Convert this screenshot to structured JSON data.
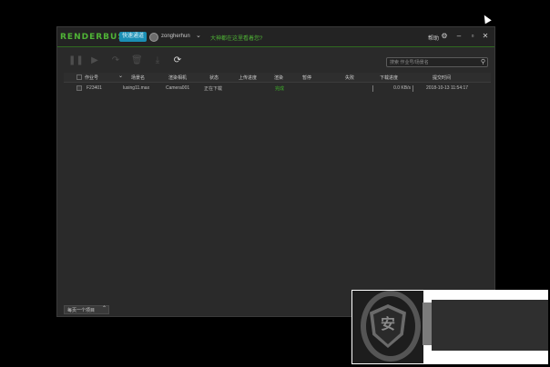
{
  "app": {
    "logo": "RENDERBUS",
    "logo_badge": "快速通道",
    "username": "zongherhun",
    "promo_link": "大神都在这里看着您?",
    "help_label": "帮助",
    "accent": "#4fb336"
  },
  "window_controls": {
    "settings_icon": "gear-icon",
    "minimize_icon": "minimize-icon",
    "maximize_icon": "maximize-icon",
    "close_icon": "close-icon"
  },
  "toolbar": {
    "tools": [
      "pause-icon",
      "play-icon",
      "redo-icon",
      "delete-icon",
      "download-icon",
      "refresh-icon"
    ]
  },
  "search": {
    "placeholder": "搜索 作业号/场景名"
  },
  "table": {
    "headers": [
      "作业号",
      "场景名",
      "渲染相机",
      "状态",
      "上传进度",
      "渲染",
      "暂停",
      "失败",
      "下载进度",
      "提交时间"
    ],
    "rows": [
      {
        "job_id": "F23401",
        "scene": "lusing11.max",
        "camera": "Camera001",
        "status": "正在下载",
        "upload": "",
        "render": "完成",
        "pause": "",
        "fail": "",
        "download": "0.0 KB/s",
        "submit_time": "2018-10-13 11:54:17"
      }
    ]
  },
  "footer": {
    "page_size_label": "每页一个项目"
  },
  "overlay": {
    "shield_char": "安"
  }
}
